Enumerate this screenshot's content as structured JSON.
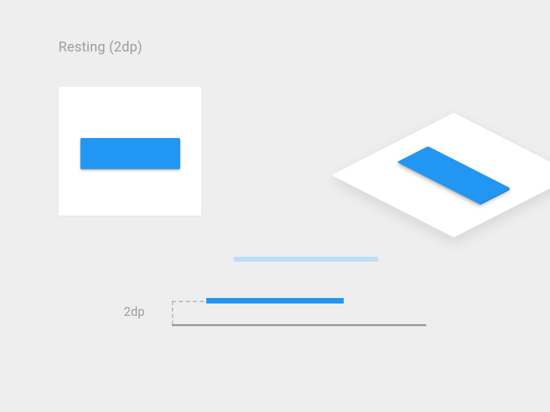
{
  "title": "Resting (2dp)",
  "elevation_label": "2dp",
  "colors": {
    "button": "#2196F3",
    "button_light": "#BBDEFB",
    "surface": "#FFFFFF",
    "ground": "#9E9E9E",
    "page_bg": "#EEEEEE",
    "text": "#9E9E9E",
    "guide": "#BDBDBD"
  },
  "elevation_dp": 2,
  "views": {
    "topdown": "Raised button on a white surface, seen from above",
    "isometric": "Same button and surface in 3/4 perspective showing the 2dp lift",
    "side": "Side profile: button bar sits 2dp above the ground line"
  }
}
